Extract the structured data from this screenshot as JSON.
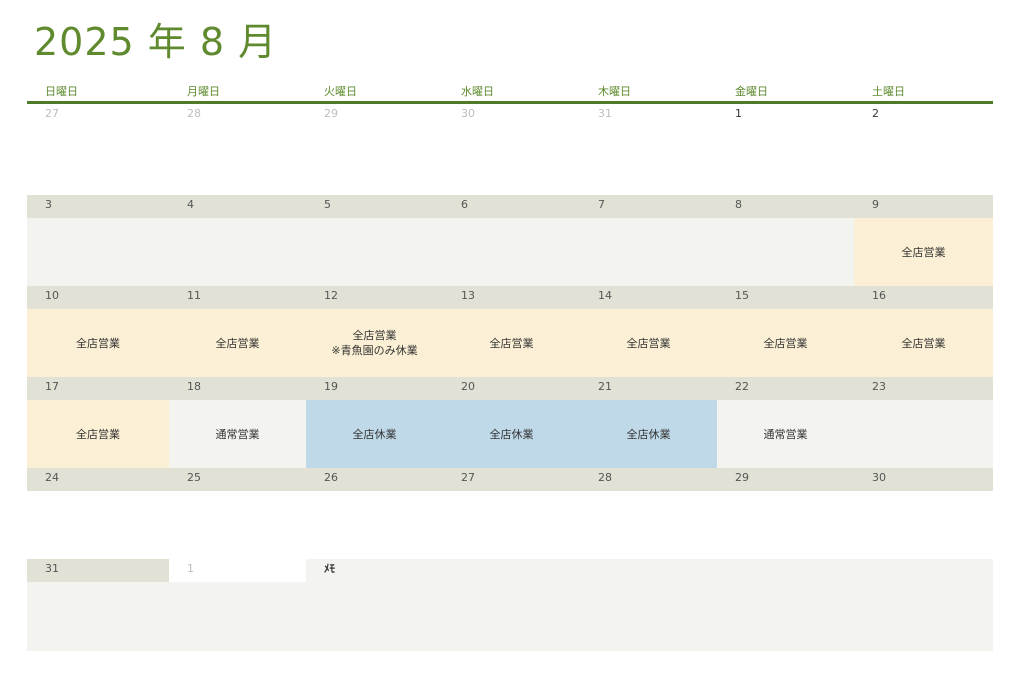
{
  "title": "2025 年 8 月",
  "weekdays": [
    "日曜日",
    "月曜日",
    "火曜日",
    "水曜日",
    "木曜日",
    "金曜日",
    "土曜日"
  ],
  "weeks": [
    {
      "days": [
        "27",
        "28",
        "29",
        "30",
        "31",
        "1",
        "2"
      ],
      "events": [
        "",
        "",
        "",
        "",
        "",
        "",
        ""
      ]
    },
    {
      "days": [
        "3",
        "4",
        "5",
        "6",
        "7",
        "8",
        "9"
      ],
      "events": [
        "",
        "",
        "",
        "",
        "",
        "",
        "全店営業"
      ]
    },
    {
      "days": [
        "10",
        "11",
        "12",
        "13",
        "14",
        "15",
        "16"
      ],
      "events": [
        "全店営業",
        "全店営業",
        "全店営業\n※青魚園のみ休業",
        "全店営業",
        "全店営業",
        "全店営業",
        "全店営業"
      ]
    },
    {
      "days": [
        "17",
        "18",
        "19",
        "20",
        "21",
        "22",
        "23"
      ],
      "events": [
        "全店営業",
        "通常営業",
        "全店休業",
        "全店休業",
        "全店休業",
        "通常営業",
        ""
      ]
    },
    {
      "days": [
        "24",
        "25",
        "26",
        "27",
        "28",
        "29",
        "30"
      ],
      "events": [
        "",
        "",
        "",
        "",
        "",
        "",
        ""
      ]
    },
    {
      "days": [
        "31",
        "1"
      ],
      "events": [
        "",
        ""
      ]
    }
  ],
  "memo": {
    "label": "ﾒﾓ"
  },
  "colors": {
    "accent": "#5f8a2e",
    "open_highlight": "#fbf0d5",
    "closed_highlight": "#bfd9e8",
    "date_bar": "#e1e2d5"
  }
}
